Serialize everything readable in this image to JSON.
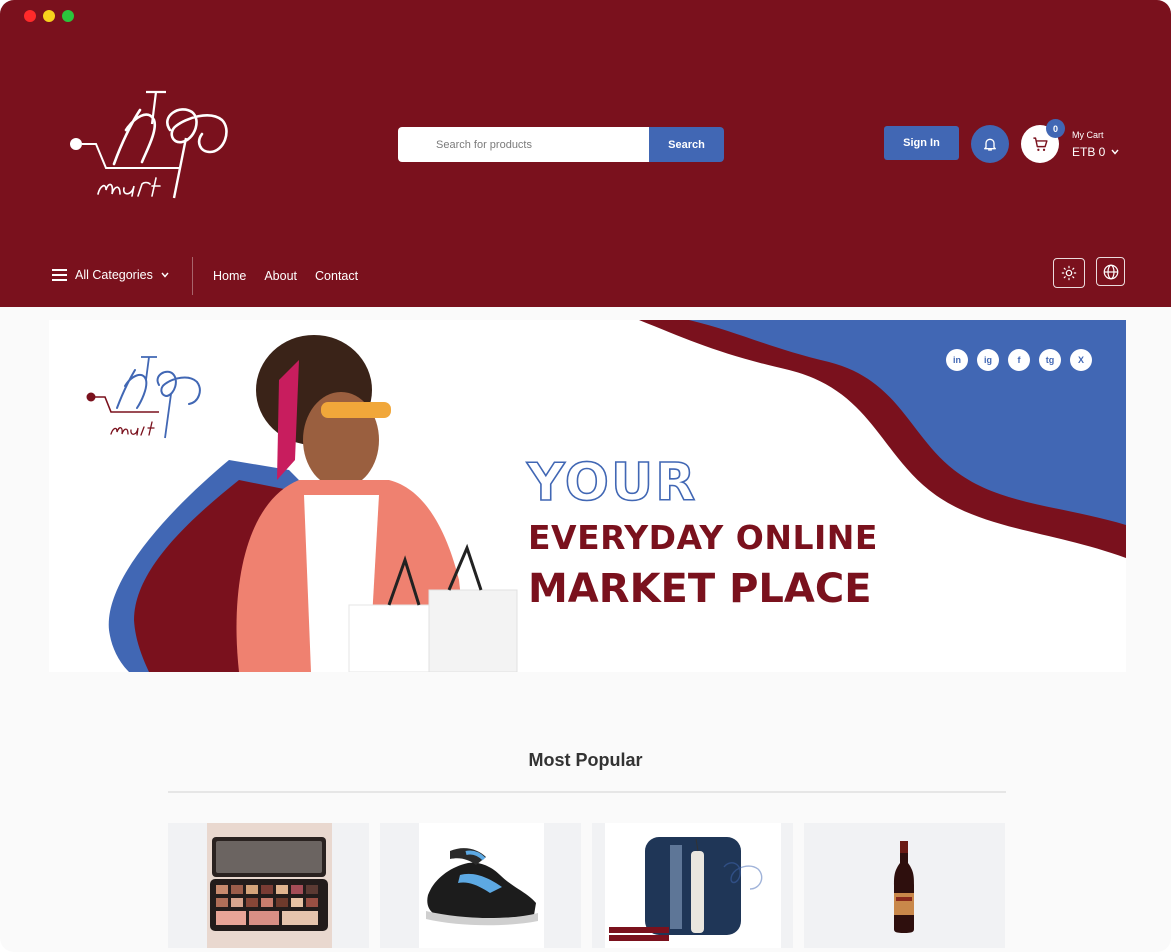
{
  "header": {
    "search": {
      "placeholder": "Search for products",
      "button_label": "Search"
    },
    "signin_label": "Sign In",
    "cart": {
      "badge_count": "0",
      "label": "My Cart",
      "total": "ETB 0"
    }
  },
  "nav": {
    "categories_label": "All Categories",
    "links": [
      "Home",
      "About",
      "Contact"
    ]
  },
  "banner": {
    "line1": "YOUR",
    "line2": "EVERYDAY ONLINE",
    "line3": "MARKET PLACE",
    "social": [
      "in",
      "ig",
      "f",
      "tg",
      "X"
    ]
  },
  "most_popular": {
    "title": "Most Popular"
  },
  "colors": {
    "brand": "#7a111d",
    "accent": "#4167b4"
  }
}
